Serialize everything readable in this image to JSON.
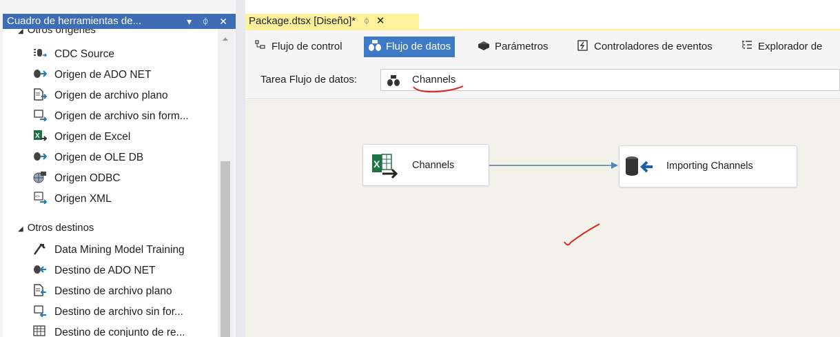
{
  "toolbox": {
    "title": "Cuadro de herramientas de...",
    "title_icons": "▾ ᛰ ✕",
    "groups": [
      {
        "label": "Otros orígenes",
        "items": [
          {
            "label": "CDC Source",
            "icon": "cdc-source-icon"
          },
          {
            "label": "Origen de ADO NET",
            "icon": "ado-net-source-icon"
          },
          {
            "label": "Origen de archivo plano",
            "icon": "flat-file-source-icon"
          },
          {
            "label": "Origen de archivo sin form...",
            "icon": "raw-file-source-icon"
          },
          {
            "label": "Origen de Excel",
            "icon": "excel-source-icon"
          },
          {
            "label": "Origen de OLE DB",
            "icon": "ole-db-source-icon"
          },
          {
            "label": "Origen ODBC",
            "icon": "odbc-source-icon"
          },
          {
            "label": "Origen XML",
            "icon": "xml-source-icon"
          }
        ]
      },
      {
        "label": "Otros destinos",
        "items": [
          {
            "label": "Data Mining Model Training",
            "icon": "data-mining-icon"
          },
          {
            "label": "Destino de ADO NET",
            "icon": "ado-net-destination-icon"
          },
          {
            "label": "Destino de archivo plano",
            "icon": "flat-file-destination-icon"
          },
          {
            "label": "Destino de archivo sin for...",
            "icon": "raw-file-destination-icon"
          },
          {
            "label": "Destino de conjunto de re...",
            "icon": "recordset-destination-icon"
          }
        ]
      }
    ]
  },
  "document_tab": {
    "title": "Package.dtsx [Diseño]*",
    "pin": "ᛰ",
    "close": "✕"
  },
  "designer_tabs": [
    {
      "label": "Flujo de control",
      "icon": "control-flow-icon",
      "active": false
    },
    {
      "label": "Flujo de datos",
      "icon": "data-flow-icon",
      "active": true
    },
    {
      "label": "Parámetros",
      "icon": "parameters-icon",
      "active": false
    },
    {
      "label": "Controladores de eventos",
      "icon": "event-handlers-icon",
      "active": false
    },
    {
      "label": "Explorador de",
      "icon": "package-explorer-icon",
      "active": false
    }
  ],
  "task_selector": {
    "label": "Tarea Flujo de datos:",
    "value": "Channels"
  },
  "canvas": {
    "nodes": [
      {
        "label": "Channels",
        "icon": "excel-source-icon"
      },
      {
        "label": "Importing Channels",
        "icon": "ole-db-destination-icon"
      }
    ]
  },
  "colors": {
    "accent": "#3e7bc7",
    "tab_yellow": "#fff29d",
    "canvas_bg": "#f3f2ea",
    "annotation_red": "#e0201c"
  }
}
